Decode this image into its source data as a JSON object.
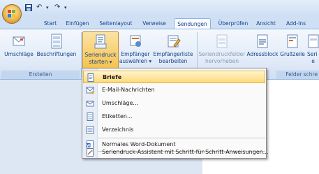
{
  "quick_access": {
    "undo_glyph": "↶",
    "redo_glyph": "↷",
    "customize_glyph": "▾"
  },
  "tabs": [
    {
      "label": "Start"
    },
    {
      "label": "Einfügen"
    },
    {
      "label": "Seitenlayout"
    },
    {
      "label": "Verweise"
    },
    {
      "label": "Sendungen",
      "active": true
    },
    {
      "label": "Überprüfen"
    },
    {
      "label": "Ansicht"
    },
    {
      "label": "Add-Ins"
    }
  ],
  "ribbon": {
    "groups": [
      {
        "label": "Erstellen"
      },
      {
        "label": "Felder schre"
      }
    ],
    "buttons": {
      "umschlaege": "Umschläge",
      "beschriftungen": "Beschriftungen",
      "seriendruck_1": "Seriendruck",
      "seriendruck_2": "starten ▾",
      "empfaenger_1": "Empfänger",
      "empfaenger_2": "auswählen ▾",
      "empfaengerliste_1": "Empfängerliste",
      "empfaengerliste_2": "bearbeiten",
      "felder_1": "Seriendruckfelder",
      "felder_2": "hervorheben",
      "adressblock": "Adressblock",
      "grusszeile": "Grußzeile",
      "seri_1": "Seri",
      "seri_2": "e"
    }
  },
  "menu": {
    "items": [
      {
        "label": "Briefe",
        "icon": "letter-icon",
        "highlighted": true
      },
      {
        "label": "E-Mail-Nachrichten",
        "icon": "email-icon"
      },
      {
        "label": "Umschläge...",
        "icon": "envelope-icon"
      },
      {
        "label": "Etiketten...",
        "icon": "labels-icon"
      },
      {
        "label": "Verzeichnis",
        "icon": "directory-icon"
      },
      {
        "label": "Normales Word-Dokument",
        "icon": "word-document-icon"
      },
      {
        "label": "Seriendruck-Assistent mit Schritt-für-Schritt-Anweisungen...",
        "icon": "wizard-icon"
      }
    ]
  }
}
